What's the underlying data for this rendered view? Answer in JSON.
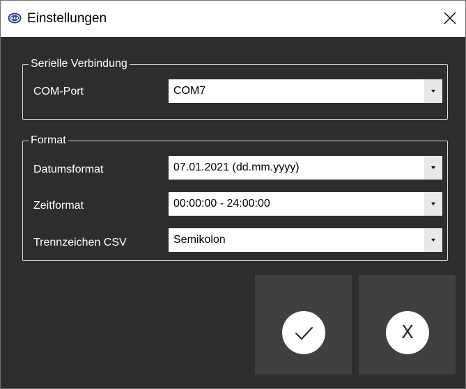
{
  "window": {
    "title": "Einstellungen",
    "app_icon": "pce-logo-icon",
    "close_icon": "close-icon"
  },
  "serial_group": {
    "legend": "Serielle Verbindung",
    "com_port": {
      "label": "COM-Port",
      "value": "COM7"
    }
  },
  "format_group": {
    "legend": "Format",
    "date_format": {
      "label": "Datumsformat",
      "value": "07.01.2021 (dd.mm.yyyy)"
    },
    "time_format": {
      "label": "Zeitformat",
      "value": "00:00:00 - 24:00:00"
    },
    "csv_separator": {
      "label": "Trennzeichen CSV",
      "value": "Semikolon"
    }
  },
  "actions": {
    "ok_icon": "checkmark-icon",
    "cancel_icon": "x-icon",
    "cancel_glyph": "X"
  },
  "colors": {
    "background": "#2d2d2d",
    "button_background": "#3f3f3f",
    "titlebar": "#ffffff",
    "text": "#ffffff"
  }
}
